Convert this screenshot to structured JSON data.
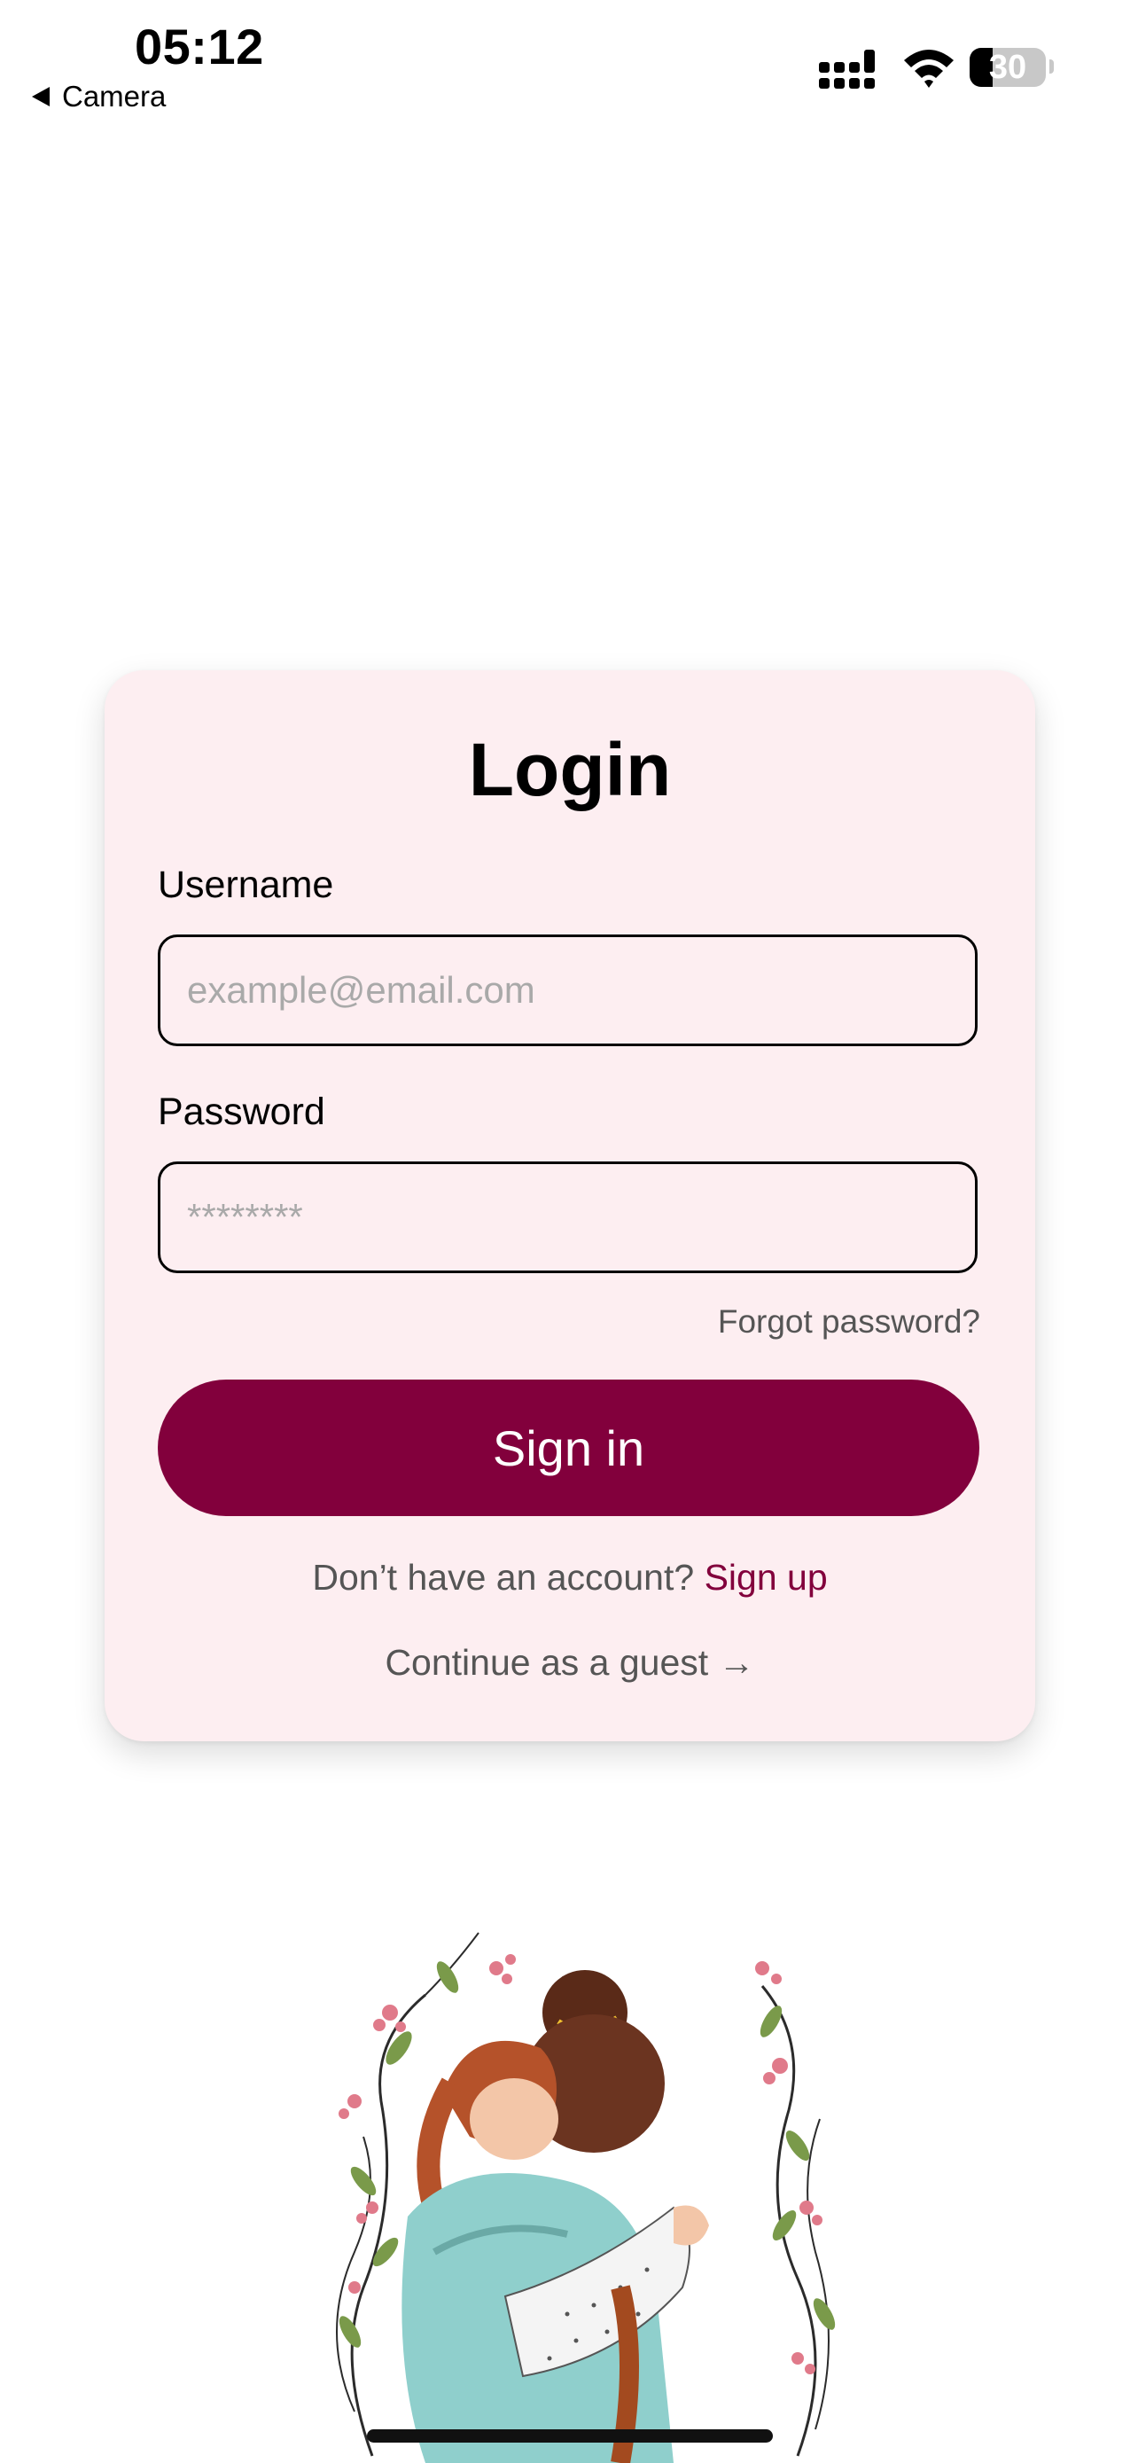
{
  "status_bar": {
    "time": "05:12",
    "back_label": "Camera",
    "battery_level": "30",
    "battery_fraction": 0.3,
    "icons": [
      "signal-icon",
      "wifi-icon",
      "battery-icon"
    ]
  },
  "login": {
    "title": "Login",
    "username_label": "Username",
    "username_placeholder": "example@email.com",
    "username_value": "",
    "password_label": "Password",
    "password_placeholder": "********",
    "password_value": "",
    "forgot_label": "Forgot password?",
    "signin_label": "Sign in",
    "no_account_text": "Don’t have an account?",
    "signup_label": "Sign up",
    "guest_label": "Continue as a guest →"
  },
  "colors": {
    "accent": "#82003c",
    "card_background": "#fdeef1",
    "muted_text": "#555555",
    "placeholder": "#a9a9a9"
  }
}
